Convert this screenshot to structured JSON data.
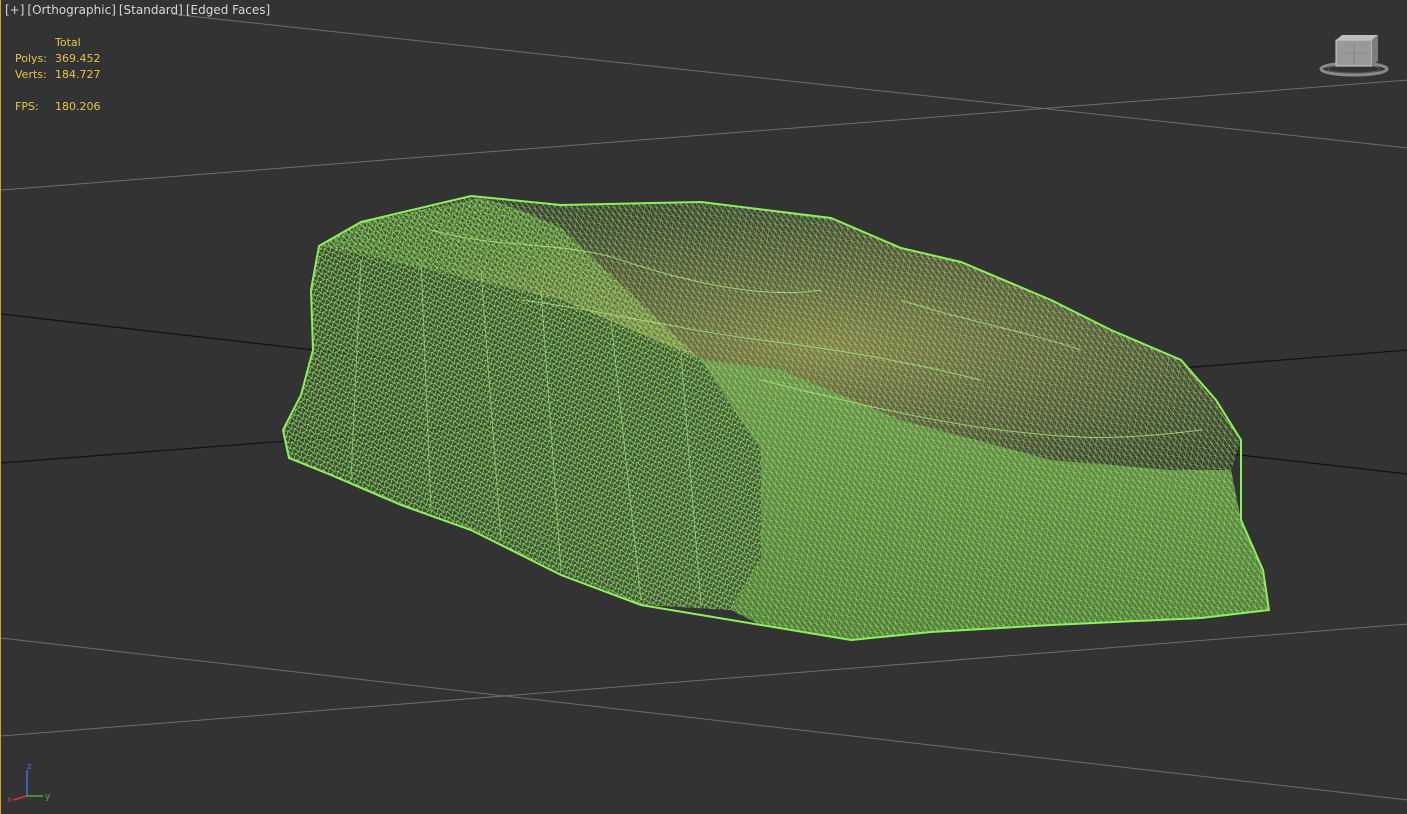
{
  "viewport": {
    "labels": {
      "plus": "[+]",
      "view": "[Orthographic]",
      "shading": "[Standard]",
      "mode": "[Edged Faces]"
    },
    "stats": {
      "header": "Total",
      "polys_label": "Polys:",
      "polys_value": "369.452",
      "verts_label": "Verts:",
      "verts_value": "184.727",
      "fps_label": "FPS:",
      "fps_value": "180.206"
    },
    "colors": {
      "background": "#333333",
      "stats_text": "#e8c34d",
      "wire": "#8cf05c",
      "active_border": "#d7a22a"
    },
    "viewcube_icon": "viewcube-icon",
    "axis_labels": {
      "z": "z",
      "y": "y",
      "x": "x"
    }
  }
}
